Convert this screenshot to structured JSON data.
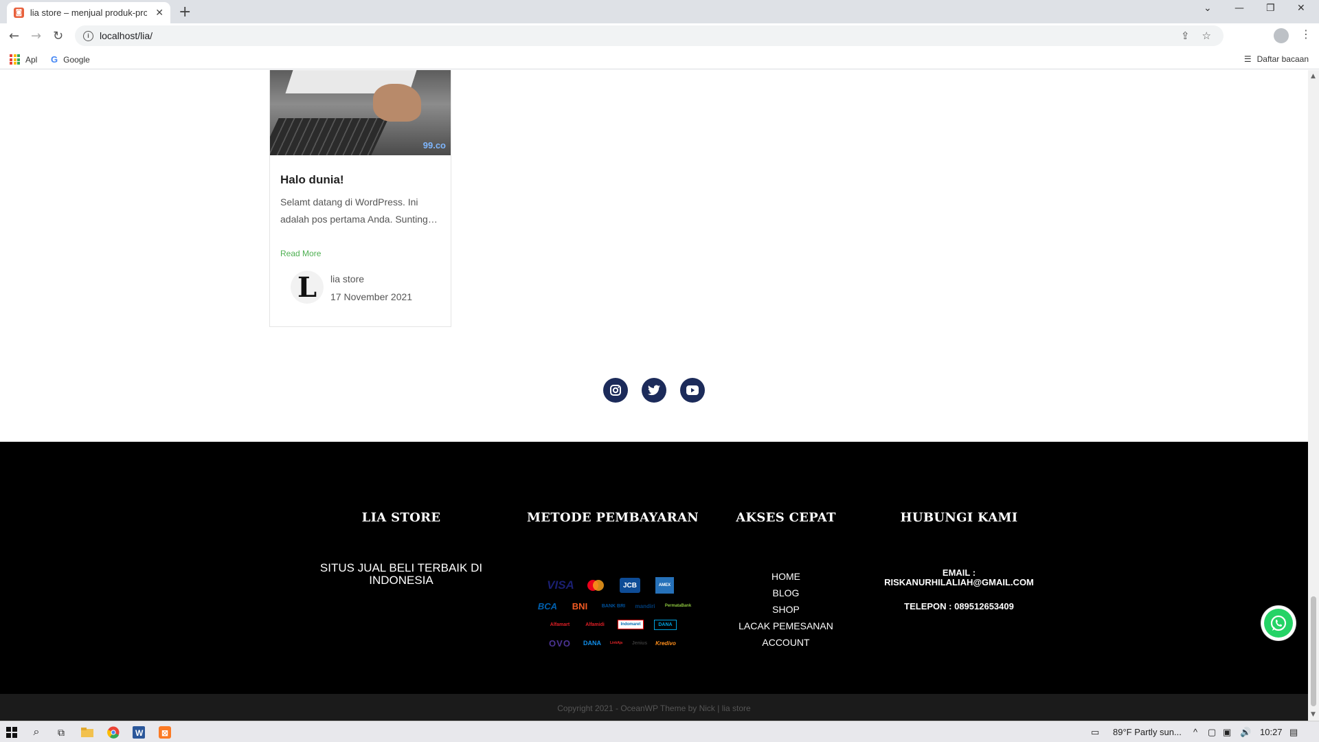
{
  "browser": {
    "tab_title": "lia store – menjual produk-produ",
    "url": "localhost/lia/",
    "bookmarks": [
      {
        "label": "Apl"
      },
      {
        "label": "Google"
      }
    ],
    "reading_list": "Daftar bacaan"
  },
  "post": {
    "image_watermark": "99.co",
    "title": "Halo dunia!",
    "excerpt": "Selamt datang di WordPress. Ini adalah pos pertama Anda. Sunting…",
    "read_more": "Read More",
    "avatar_letter": "L",
    "author": "lia store",
    "date": "17 November 2021"
  },
  "social": [
    {
      "icon": "instagram-icon"
    },
    {
      "icon": "twitter-icon"
    },
    {
      "icon": "youtube-icon"
    }
  ],
  "footer": {
    "store": {
      "heading": "LIA STORE",
      "description": "SITUS JUAL BELI TERBAIK DI INDONESIA"
    },
    "payment": {
      "heading": "METODE PEMBAYARAN",
      "methods": [
        "VISA",
        "mastercard",
        "JCB",
        "AMEX",
        "BCA",
        "BNI",
        "BANK BRI",
        "mandiri",
        "PermataBank",
        "Alfamart",
        "Alfamidi",
        "Indomaret",
        "DANA",
        "OVO",
        "DANA",
        "LinkAja",
        "Jenius",
        "Kredivo"
      ]
    },
    "quick": {
      "heading": "AKSES CEPAT",
      "links": [
        "HOME",
        "BLOG",
        "SHOP",
        "LACAK PEMESANAN",
        "ACCOUNT"
      ]
    },
    "contact": {
      "heading": "HUBUNGI KAMI",
      "email_label": "EMAIL :",
      "email": "RISKANURHILALIAH@GMAIL.COM",
      "phone": "TELEPON : 089512653409"
    },
    "copyright": "Copyright 2021 - OceanWP Theme by Nick | lia store"
  },
  "taskbar": {
    "weather": "89°F  Partly sun...",
    "time": "10:27"
  },
  "colors": {
    "accent_green": "#4caf50",
    "social_navy": "#1c2b5a",
    "footer_bg": "#000000"
  }
}
